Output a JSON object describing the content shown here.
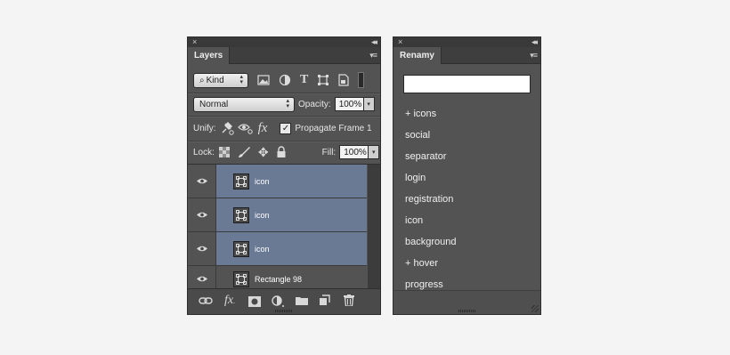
{
  "layers_panel": {
    "close_glyph": "×",
    "collapse_glyph": "◂◂",
    "tab_label": "Layers",
    "menu_glyph": "▾≡",
    "filter": {
      "kind_label": "Kind",
      "search_glyph": "⌕"
    },
    "blend_mode": "Normal",
    "opacity_label": "Opacity:",
    "opacity_value": "100%",
    "unify_label": "Unify:",
    "propagate_label": "Propagate Frame 1",
    "propagate_checked": true,
    "lock_label": "Lock:",
    "fill_label": "Fill:",
    "fill_value": "100%",
    "layers": [
      {
        "name": "icon",
        "selected": true
      },
      {
        "name": "icon",
        "selected": true
      },
      {
        "name": "icon",
        "selected": true
      },
      {
        "name": "Rectangle 98",
        "selected": false
      }
    ],
    "bottom_icons": [
      "link-icon",
      "fx-icon",
      "mask-icon",
      "adjustment-icon",
      "folder-icon",
      "new-layer-icon",
      "trash-icon"
    ]
  },
  "renamy_panel": {
    "close_glyph": "×",
    "collapse_glyph": "◂◂",
    "tab_label": "Renamy",
    "menu_glyph": "▾≡",
    "input_value": "",
    "items": [
      "+ icons",
      "social",
      "separator",
      "login",
      "registration",
      "icon",
      "background",
      "+ hover",
      "progress"
    ]
  },
  "colors": {
    "panel_bg": "#535353",
    "selected_layer": "#6a7a94",
    "page_bg": "#f4f4f4"
  }
}
